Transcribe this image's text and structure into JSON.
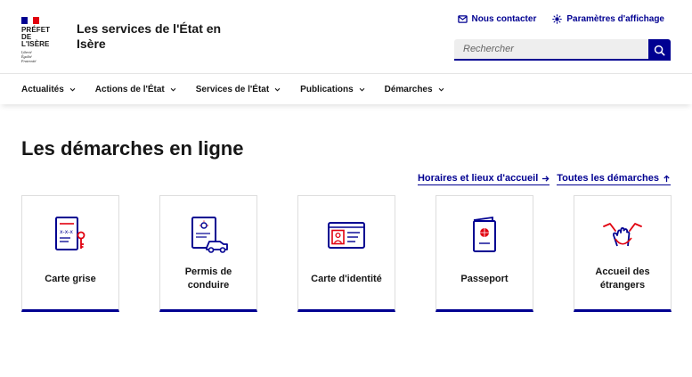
{
  "colors": {
    "primary": "#000091",
    "accent": "#e1000f",
    "flag_blue": "#000091",
    "flag_white": "#ffffff",
    "flag_red": "#e1000f"
  },
  "logo": {
    "line1": "PRÉFET",
    "line2": "DE L'ISÈRE",
    "motto1": "Liberté",
    "motto2": "Égalité",
    "motto3": "Fraternité"
  },
  "header": {
    "site_title": "Les services de l'État en Isère",
    "contact_label": "Nous contacter",
    "contact_icon": "mail-icon",
    "display_label": "Paramètres d'affichage",
    "display_icon": "sun-icon"
  },
  "search": {
    "placeholder": "Rechercher",
    "button_icon": "search-icon"
  },
  "nav": {
    "items": [
      {
        "label": "Actualités"
      },
      {
        "label": "Actions de l'État"
      },
      {
        "label": "Services de l'État"
      },
      {
        "label": "Publications"
      },
      {
        "label": "Démarches"
      }
    ]
  },
  "main": {
    "title": "Les démarches en ligne",
    "links": [
      {
        "label": "Horaires et lieux d'accueil",
        "icon": "arrow-right-icon"
      },
      {
        "label": "Toutes les démarches",
        "icon": "arrow-up-right-icon"
      }
    ],
    "cards": [
      {
        "label": "Carte grise",
        "icon": "vehicle-registration-icon"
      },
      {
        "label": "Permis de conduire",
        "icon": "driving-license-icon"
      },
      {
        "label": "Carte d'identité",
        "icon": "identity-card-icon"
      },
      {
        "label": "Passeport",
        "icon": "passport-icon"
      },
      {
        "label": "Accueil des étrangers",
        "icon": "hands-welcome-icon"
      }
    ]
  }
}
